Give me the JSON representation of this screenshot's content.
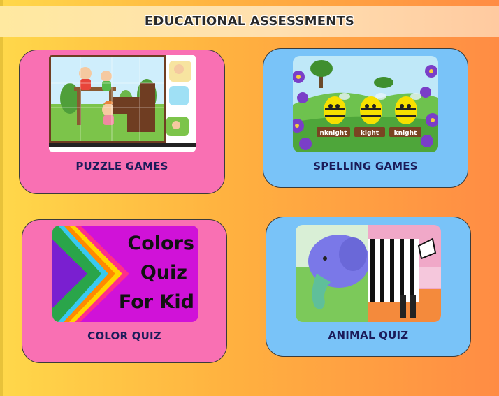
{
  "header": {
    "title": "EDUCATIONAL ASSESSMENTS"
  },
  "cards": [
    {
      "label": "PUZZLE GAMES",
      "color": "#f970b3",
      "icon": "puzzle-image"
    },
    {
      "label": "SPELLING GAMES",
      "color": "#79c3f8",
      "icon": "bees-spelling-image",
      "words": [
        "nknight",
        "kight",
        "knight"
      ]
    },
    {
      "label": "COLOR QUIZ",
      "color": "#f970b3",
      "icon": "colors-quiz-image",
      "image_text": [
        "Colors",
        "Quiz",
        "For Kid"
      ]
    },
    {
      "label": "ANIMAL QUIZ",
      "color": "#79c3f8",
      "icon": "elephant-zebra-image"
    }
  ]
}
